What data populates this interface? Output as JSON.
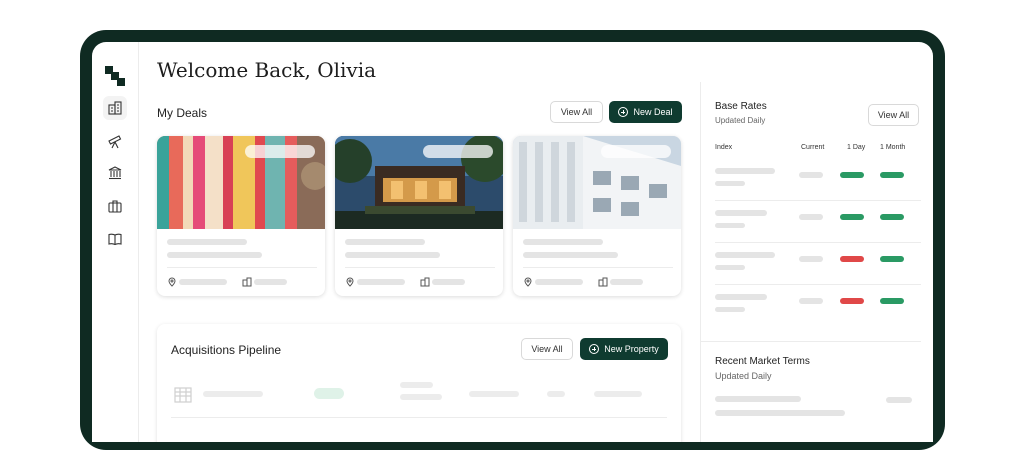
{
  "header": {
    "title": "Welcome Back, Olivia"
  },
  "sidebar": {
    "items": [
      {
        "icon": "building-icon",
        "active": true
      },
      {
        "icon": "telescope-icon",
        "active": false
      },
      {
        "icon": "bank-icon",
        "active": false
      },
      {
        "icon": "briefcase-icon",
        "active": false
      },
      {
        "icon": "book-icon",
        "active": false
      }
    ]
  },
  "deals": {
    "title": "My Deals",
    "view_all_label": "View All",
    "new_label": "New Deal"
  },
  "pipeline": {
    "title": "Acquisitions Pipeline",
    "view_all_label": "View All",
    "new_label": "New Property"
  },
  "rates": {
    "title": "Base Rates",
    "subtitle": "Updated Daily",
    "view_all_label": "View All",
    "columns": [
      "Index",
      "Current",
      "1 Day",
      "1 Month"
    ],
    "rows": [
      {
        "day": "up",
        "month": "up"
      },
      {
        "day": "up",
        "month": "up"
      },
      {
        "day": "down",
        "month": "up"
      },
      {
        "day": "down",
        "month": "up"
      }
    ],
    "colors": {
      "up": "#2a9a64",
      "down": "#e04848"
    }
  },
  "market": {
    "title": "Recent Market Terms",
    "subtitle": "Updated Daily"
  }
}
